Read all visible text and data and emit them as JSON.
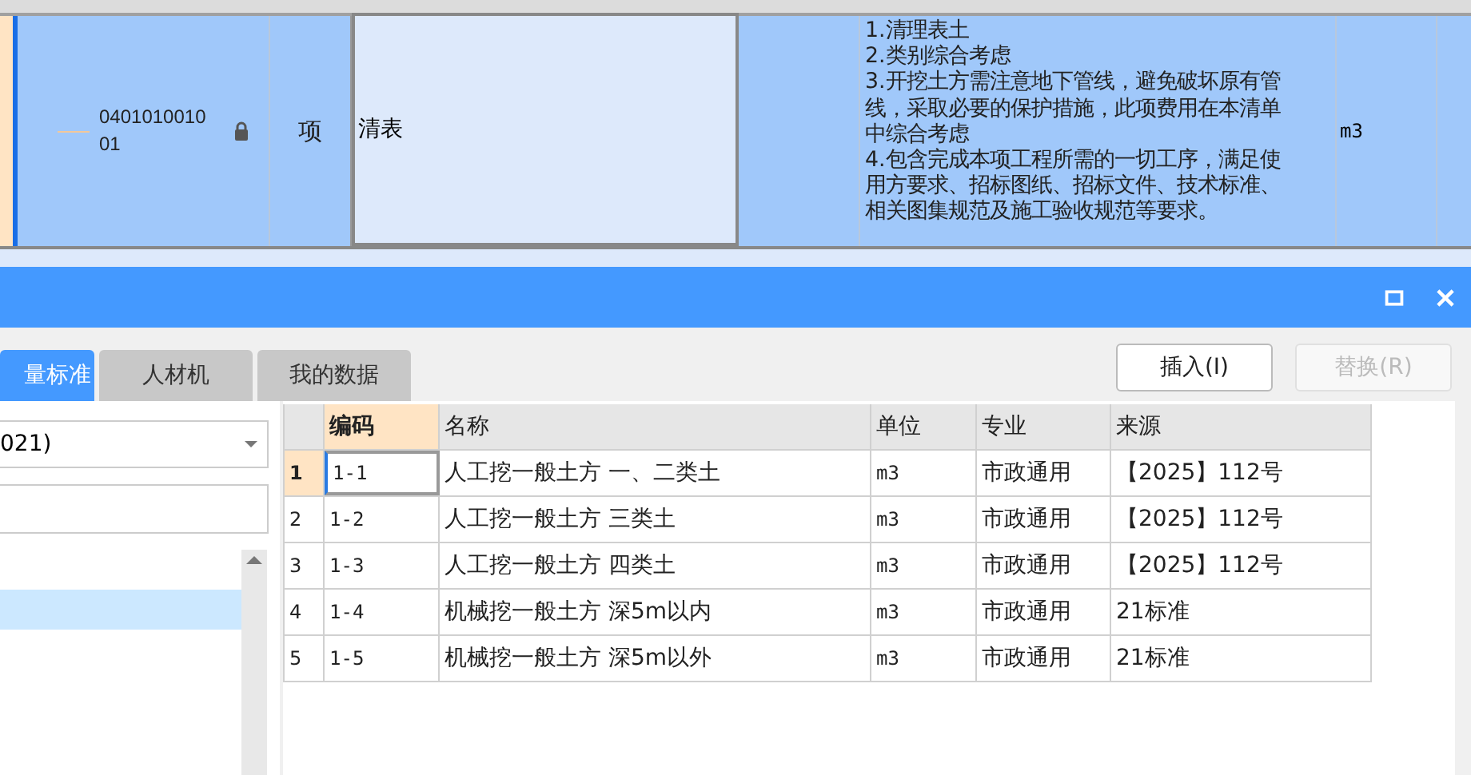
{
  "bill_table": {
    "row": {
      "selected": true,
      "code": "040101001001",
      "locked": true,
      "type": "项",
      "name": "清表",
      "features": [
        "1.清理表土",
        "2.类别综合考虑",
        "3.开挖土方需注意地下管线，避免破坏原有管线，采取必要的保护措施，此项费用在本清单中综合考虑",
        "4.包含完成本项工程所需的一切工序，满足使用方要求、招标图纸、招标文件、技术标准、相关图集规范及施工验收规范等要求。"
      ],
      "unit": "m3"
    }
  },
  "dialog": {
    "tabs": [
      {
        "label": "量标准",
        "selected": true
      },
      {
        "label": "人材机",
        "selected": false
      },
      {
        "label": "我的数据",
        "selected": false
      }
    ],
    "buttons": [
      {
        "label": "插入(I)",
        "disabled": false
      },
      {
        "label": "替换(R)",
        "disabled": true
      }
    ],
    "library": {
      "value": "021)"
    },
    "list": {
      "items": [
        {
          "selected": true
        }
      ]
    },
    "grid": {
      "columns": [
        {
          "label": "编码",
          "selected": true
        },
        {
          "label": "名称",
          "selected": false
        },
        {
          "label": "单位",
          "selected": false
        },
        {
          "label": "专业",
          "selected": false
        },
        {
          "label": "来源",
          "selected": false
        }
      ],
      "rows": [
        {
          "number": "1",
          "selected": true,
          "cells": [
            "1-1",
            "人工挖一般土方 一、二类土",
            "m3",
            "市政通用",
            "【2025】112号"
          ]
        },
        {
          "number": "2",
          "selected": false,
          "cells": [
            "1-2",
            "人工挖一般土方 三类土",
            "m3",
            "市政通用",
            "【2025】112号"
          ]
        },
        {
          "number": "3",
          "selected": false,
          "cells": [
            "1-3",
            "人工挖一般土方 四类土",
            "m3",
            "市政通用",
            "【2025】112号"
          ]
        },
        {
          "number": "4",
          "selected": false,
          "cells": [
            "1-4",
            "机械挖一般土方 深5m以内",
            "m3",
            "市政通用",
            "21标准"
          ]
        },
        {
          "number": "5",
          "selected": false,
          "cells": [
            "1-5",
            "机械挖一般土方 深5m以外",
            "m3",
            "市政通用",
            "21标准"
          ]
        }
      ]
    }
  }
}
